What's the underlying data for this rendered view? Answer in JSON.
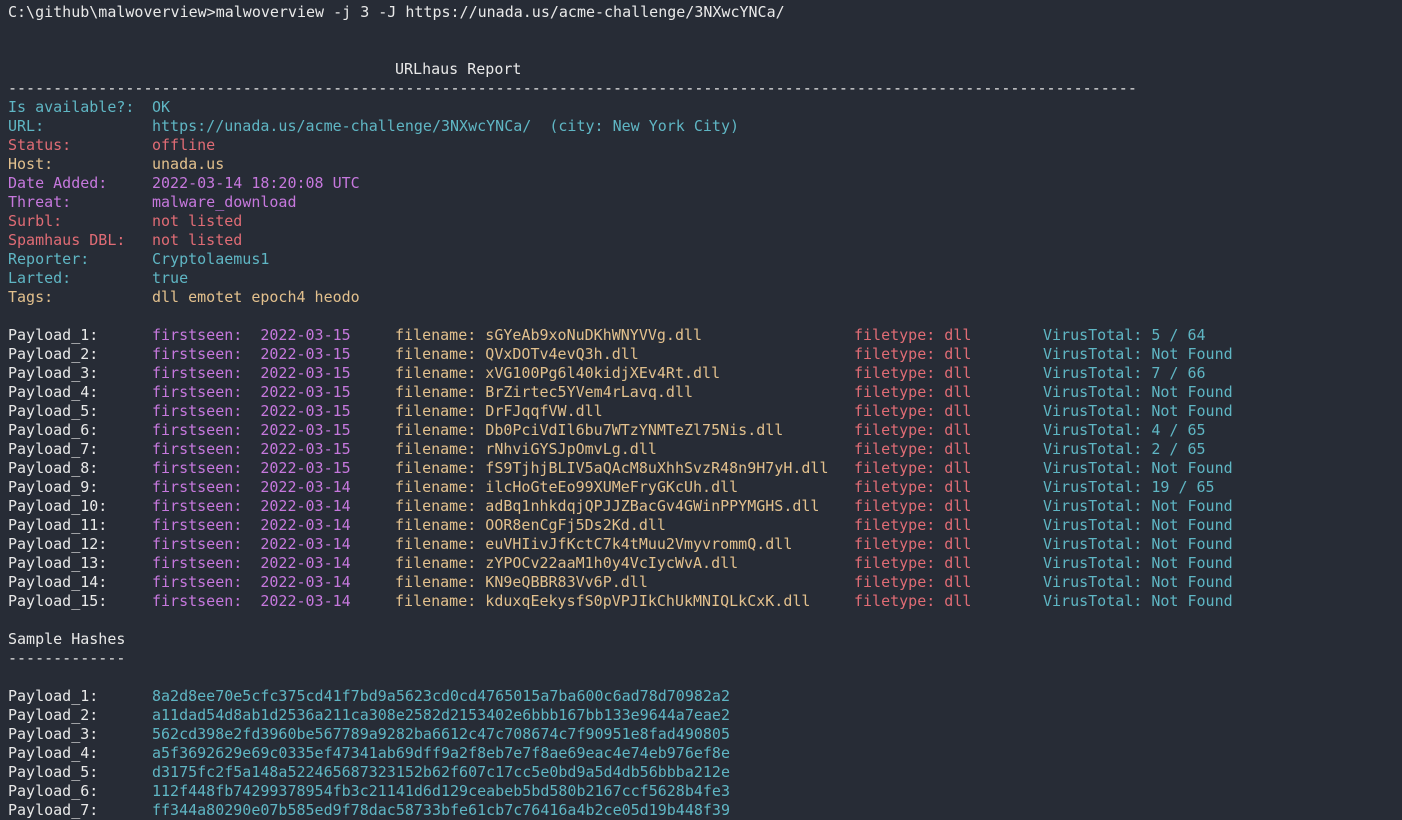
{
  "command": "C:\\github\\malwoverview>malwoverview -j 3 -J https://unada.us/acme-challenge/3NXwcYNCa/",
  "report_title": "URLhaus Report",
  "separator": "-----------------------------------------------------------------------------------------------------------------------------",
  "fields": [
    {
      "label": "Is available?:",
      "value": "OK"
    },
    {
      "label": "URL:",
      "value": "https://unada.us/acme-challenge/3NXwcYNCa/  (city: New York City)"
    },
    {
      "label": "Status:",
      "value": "offline"
    },
    {
      "label": "Host:",
      "value": "unada.us"
    },
    {
      "label": "Date Added:",
      "value": "2022-03-14 18:20:08 UTC"
    },
    {
      "label": "Threat:",
      "value": "malware_download"
    },
    {
      "label": "Surbl:",
      "value": "not listed"
    },
    {
      "label": "Spamhaus DBL:",
      "value": "not listed"
    },
    {
      "label": "Reporter:",
      "value": "Cryptolaemus1"
    },
    {
      "label": "Larted:",
      "value": "true"
    },
    {
      "label": "Tags:",
      "value": "dll emotet epoch4 heodo"
    }
  ],
  "payloads": [
    {
      "label": "Payload_1:",
      "firstseen": "firstseen:  2022-03-15",
      "filename": "filename: sGYeAb9xoNuDKhWNYVVg.dll",
      "filetype": "filetype: dll",
      "virustotal": "VirusTotal: 5 / 64"
    },
    {
      "label": "Payload_2:",
      "firstseen": "firstseen:  2022-03-15",
      "filename": "filename: QVxDOTv4evQ3h.dll",
      "filetype": "filetype: dll",
      "virustotal": "VirusTotal: Not Found"
    },
    {
      "label": "Payload_3:",
      "firstseen": "firstseen:  2022-03-15",
      "filename": "filename: xVG100Pg6l40kidjXEv4Rt.dll",
      "filetype": "filetype: dll",
      "virustotal": "VirusTotal: 7 / 66"
    },
    {
      "label": "Payload_4:",
      "firstseen": "firstseen:  2022-03-15",
      "filename": "filename: BrZirtec5YVem4rLavq.dll",
      "filetype": "filetype: dll",
      "virustotal": "VirusTotal: Not Found"
    },
    {
      "label": "Payload_5:",
      "firstseen": "firstseen:  2022-03-15",
      "filename": "filename: DrFJqqfVW.dll",
      "filetype": "filetype: dll",
      "virustotal": "VirusTotal: Not Found"
    },
    {
      "label": "Payload_6:",
      "firstseen": "firstseen:  2022-03-15",
      "filename": "filename: Db0PciVdIl6bu7WTzYNMTeZl75Nis.dll",
      "filetype": "filetype: dll",
      "virustotal": "VirusTotal: 4 / 65"
    },
    {
      "label": "Payload_7:",
      "firstseen": "firstseen:  2022-03-15",
      "filename": "filename: rNhviGYSJpOmvLg.dll",
      "filetype": "filetype: dll",
      "virustotal": "VirusTotal: 2 / 65"
    },
    {
      "label": "Payload_8:",
      "firstseen": "firstseen:  2022-03-15",
      "filename": "filename: fS9TjhjBLIV5aQAcM8uXhhSvzR48n9H7yH.dll",
      "filetype": "filetype: dll",
      "virustotal": "VirusTotal: Not Found"
    },
    {
      "label": "Payload_9:",
      "firstseen": "firstseen:  2022-03-14",
      "filename": "filename: ilcHoGteEo99XUMeFryGKcUh.dll",
      "filetype": "filetype: dll",
      "virustotal": "VirusTotal: 19 / 65"
    },
    {
      "label": "Payload_10:",
      "firstseen": "firstseen:  2022-03-14",
      "filename": "filename: adBq1nhkdqjQPJJZBacGv4GWinPPYMGHS.dll",
      "filetype": "filetype: dll",
      "virustotal": "VirusTotal: Not Found"
    },
    {
      "label": "Payload_11:",
      "firstseen": "firstseen:  2022-03-14",
      "filename": "filename: OOR8enCgFj5Ds2Kd.dll",
      "filetype": "filetype: dll",
      "virustotal": "VirusTotal: Not Found"
    },
    {
      "label": "Payload_12:",
      "firstseen": "firstseen:  2022-03-14",
      "filename": "filename: euVHIivJfKctC7k4tMuu2VmyvrommQ.dll",
      "filetype": "filetype: dll",
      "virustotal": "VirusTotal: Not Found"
    },
    {
      "label": "Payload_13:",
      "firstseen": "firstseen:  2022-03-14",
      "filename": "filename: zYPOCv22aaM1h0y4VcIycWvA.dll",
      "filetype": "filetype: dll",
      "virustotal": "VirusTotal: Not Found"
    },
    {
      "label": "Payload_14:",
      "firstseen": "firstseen:  2022-03-14",
      "filename": "filename: KN9eQBBR83Vv6P.dll",
      "filetype": "filetype: dll",
      "virustotal": "VirusTotal: Not Found"
    },
    {
      "label": "Payload_15:",
      "firstseen": "firstseen:  2022-03-14",
      "filename": "filename: kduxqEekysfS0pVPJIkChUkMNIQLkCxK.dll",
      "filetype": "filetype: dll",
      "virustotal": "VirusTotal: Not Found"
    }
  ],
  "hashes_title": "Sample Hashes",
  "hashes_underline": "-------------",
  "hashes": [
    {
      "label": "Payload_1:",
      "value": "8a2d8ee70e5cfc375cd41f7bd9a5623cd0cd4765015a7ba600c6ad78d70982a2"
    },
    {
      "label": "Payload_2:",
      "value": "a11dad54d8ab1d2536a211ca308e2582d2153402e6bbb167bb133e9644a7eae2"
    },
    {
      "label": "Payload_3:",
      "value": "562cd398e2fd3960be567789a9282ba6612c47c708674c7f90951e8fad490805"
    },
    {
      "label": "Payload_4:",
      "value": "a5f3692629e69c0335ef47341ab69dff9a2f8eb7e7f8ae69eac4e74eb976ef8e"
    },
    {
      "label": "Payload_5:",
      "value": "d3175fc2f5a148a522465687323152b62f607c17cc5e0bd9a5d4db56bbba212e"
    },
    {
      "label": "Payload_6:",
      "value": "112f448fb74299378954fb3c21141d6d129ceabeb5bd580b2167ccf5628b4fe3"
    },
    {
      "label": "Payload_7:",
      "value": "ff344a80290e07b585ed9f78dac58733bfe61cb7c76416a4b2ce05d19b448f39"
    }
  ],
  "colors": {
    "background": "#272c36",
    "white": "#e9e9e9",
    "cyan": "#5fb6c4",
    "red": "#e06c75",
    "yellow": "#e2c08d",
    "magenta": "#c678dd"
  }
}
